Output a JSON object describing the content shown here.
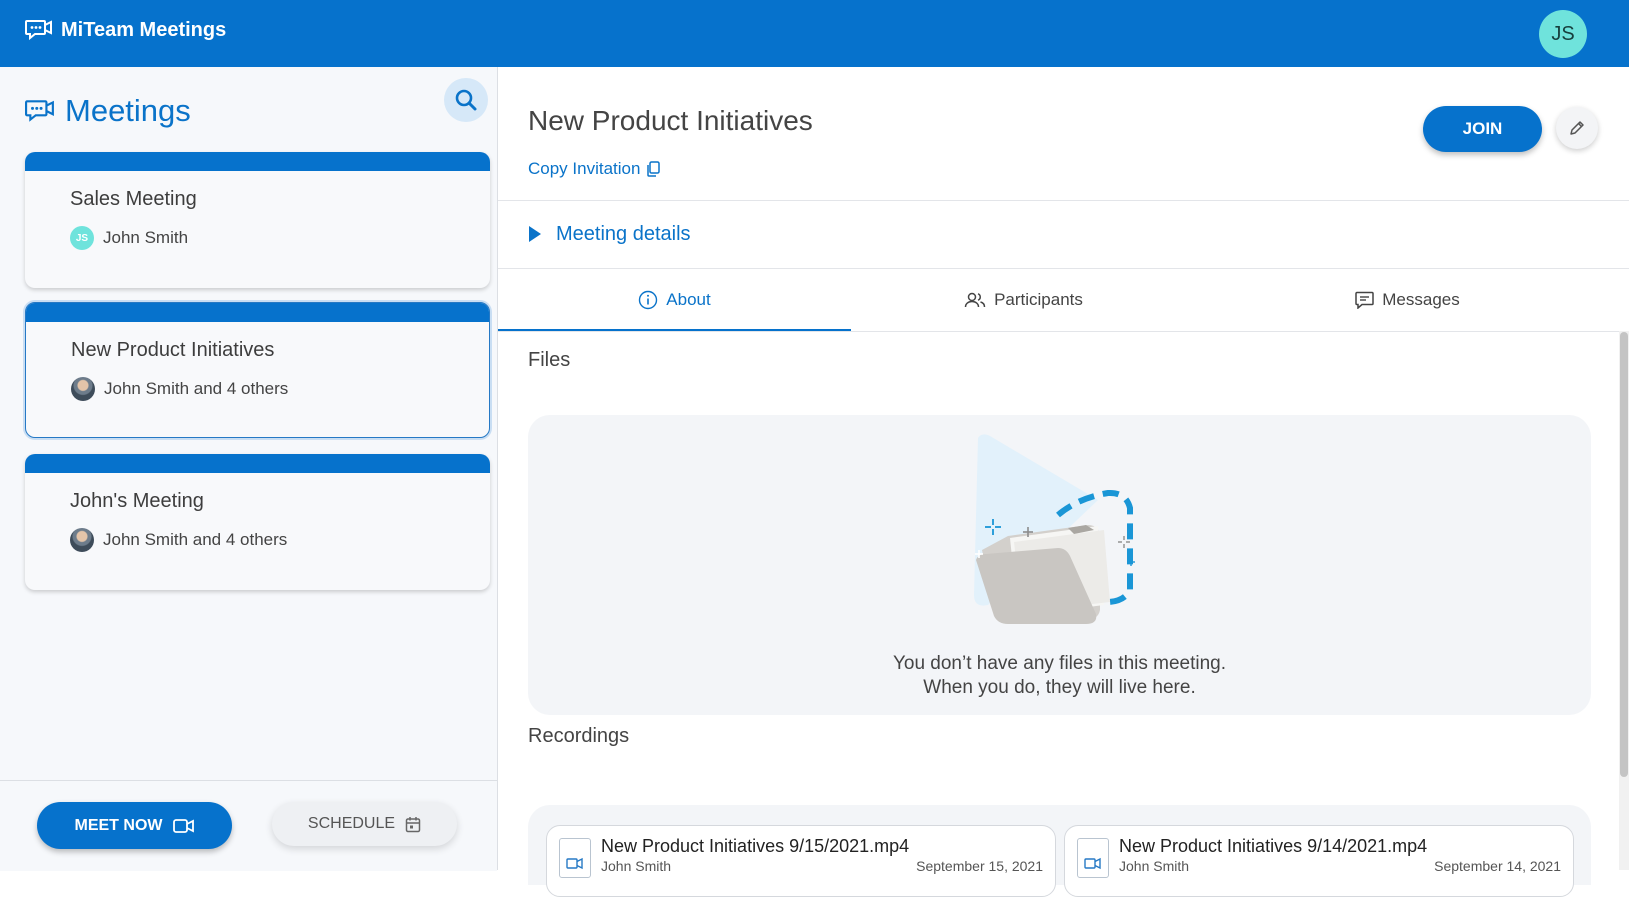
{
  "header": {
    "app_title": "MiTeam Meetings",
    "user_initials": "JS",
    "app_icon": "chat-video-icon"
  },
  "sidebar": {
    "title": "Meetings",
    "meetings": [
      {
        "title": "Sales Meeting",
        "host": "John Smith",
        "avatar_initials": "JS"
      },
      {
        "title": "New Product Initiatives",
        "host": "John Smith and 4 others",
        "selected": true
      },
      {
        "title": "John's Meeting",
        "host": "John Smith and 4 others"
      }
    ],
    "meet_now_label": "MEET NOW",
    "schedule_label": "SCHEDULE"
  },
  "meeting": {
    "title": "New Product Initiatives",
    "copy_invitation": "Copy Invitation",
    "join_label": "JOIN",
    "details_label": "Meeting details",
    "tabs": [
      {
        "label": "About",
        "active": true
      },
      {
        "label": "Participants"
      },
      {
        "label": "Messages"
      }
    ],
    "files": {
      "title": "Files",
      "empty_line1": "You don’t have any files in this meeting.",
      "empty_line2": "When you do, they will live here."
    },
    "recordings": {
      "title": "Recordings",
      "items": [
        {
          "name": "New Product Initiatives 9/15/2021.mp4",
          "author": "John Smith",
          "date": "September 15, 2021"
        },
        {
          "name": "New Product Initiatives 9/14/2021.mp4",
          "author": "John Smith",
          "date": "September 14, 2021"
        }
      ]
    }
  },
  "colors": {
    "brand": "#0672cc",
    "accent_avatar": "#6fe3dc",
    "link": "#0a73c9"
  }
}
